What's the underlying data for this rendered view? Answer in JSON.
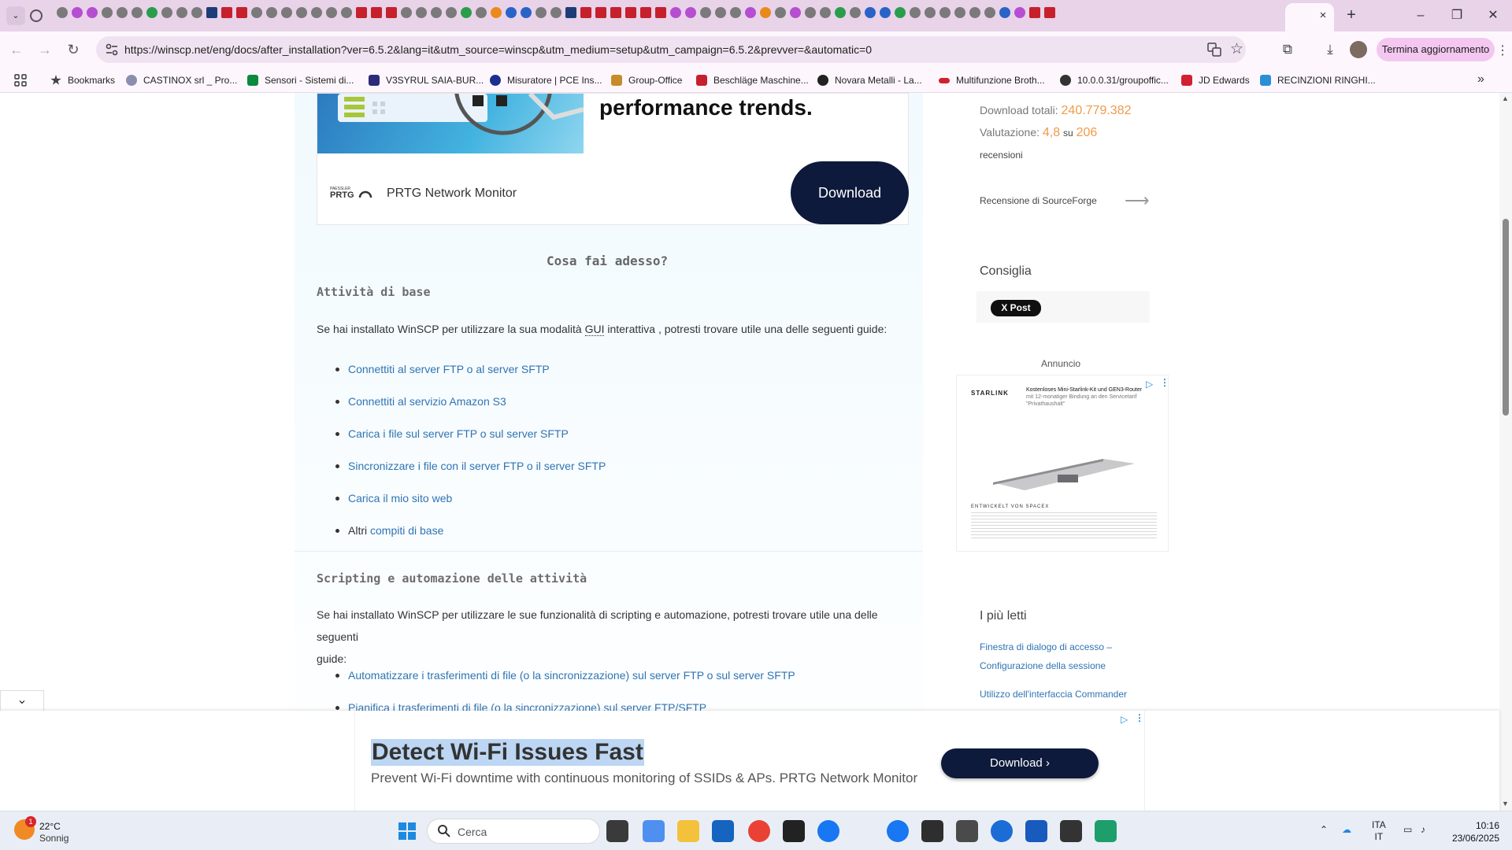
{
  "browser": {
    "tab_close_label": "×",
    "new_tab_label": "+",
    "url": "https://winscp.net/eng/docs/after_installation?ver=6.5.2&lang=it&utm_source=winscp&utm_medium=setup&utm_campaign=6.5.2&prevver=&automatic=0",
    "update_button": "Termina aggiornamento",
    "bookmarks": [
      {
        "label": "Bookmarks",
        "icon": "star-icon",
        "color": "#444444"
      },
      {
        "label": "CASTINOX srl _ Pro...",
        "icon": "globe-icon",
        "color": "#8a8fb0"
      },
      {
        "label": "Sensori - Sistemi di...",
        "icon": "s-logo-icon",
        "color": "#0a8a3c"
      },
      {
        "label": "V3SYRUL SAIA-BUR...",
        "icon": "grid-logo-icon",
        "color": "#2b2b7a"
      },
      {
        "label": "Misuratore | PCE Ins...",
        "icon": "pce-logo-icon",
        "color": "#1d2f8e"
      },
      {
        "label": "Group-Office",
        "icon": "group-office-icon",
        "color": "#c78b2a"
      },
      {
        "label": "Beschläge Maschine...",
        "icon": "k-logo-icon",
        "color": "#c6202c"
      },
      {
        "label": "Novara Metalli - La...",
        "icon": "novara-logo-icon",
        "color": "#222222"
      },
      {
        "label": "Multifunzione Broth...",
        "icon": "brother-logo-icon",
        "color": "#d1202f"
      },
      {
        "label": "10.0.0.31/groupoffic...",
        "icon": "globe-icon",
        "color": "#333333"
      },
      {
        "label": "JD Edwards",
        "icon": "jde-logo-icon",
        "color": "#d1202f"
      },
      {
        "label": "RECINZIONI RINGHI...",
        "icon": "ringhi-logo-icon",
        "color": "#2b8fd6"
      }
    ]
  },
  "top_ad": {
    "headline": "performance trends.",
    "product": "PRTG Network Monitor",
    "brand": "PAESSLER PRTG",
    "download": "Download"
  },
  "content": {
    "title": "Cosa fai adesso?",
    "section1_title": "Attività di base",
    "section1_intro_pre": "Se hai installato WinSCP per utilizzare la sua modalità ",
    "section1_intro_abbr": "GUI",
    "section1_intro_post": " interattiva , potresti trovare utile una delle seguenti guide:",
    "section1_links": [
      "Connettiti al server FTP o al server SFTP",
      "Connettiti al servizio Amazon S3",
      "Carica i file sul server FTP o sul server SFTP",
      "Sincronizzare i file con il server FTP o il server SFTP",
      "Carica il mio sito web"
    ],
    "section1_last_prefix": "Altri ",
    "section1_last_link": "compiti di base",
    "section2_title": "Scripting e automazione delle attività",
    "section2_intro_line1": "Se hai installato WinSCP per utilizzare le sue funzionalità di scripting e automazione, potresti trovare utile una delle seguenti",
    "section2_intro_line2": "guide:",
    "section2_links": [
      "Automatizzare i trasferimenti di file (o la sincronizzazione) sul server FTP o sul server SFTP",
      "Pianifica i trasferimenti di file (o la sincronizzazione) sul server FTP/SFTP"
    ]
  },
  "sidebar": {
    "downloads_label": "Download totali:",
    "downloads_value": "240.779.382",
    "rating_label": "Valutazione:",
    "rating_value": "4,8",
    "rating_su": "su",
    "rating_count": "206",
    "reviews_label": "recensioni",
    "sf_review": "Recensione di SourceForge",
    "sf_arrow": "⟶",
    "recommend_title": "Consiglia",
    "x_post": "X Post",
    "ad_label": "Annuncio",
    "starlink": {
      "logo": "STARLINK",
      "headline": "Kostenloses Mini-Starlink-Kit und GEN3-Router",
      "body": "mit 12-monatiger Bindung an den Servicetarif \"Privathaushalt\"",
      "footer": "ENTWICKELT VON SPACEX"
    },
    "most_read_title": "I più letti",
    "most_read_links": [
      "Finestra di dialogo di accesso –",
      "Configurazione della sessione",
      "Utilizzo dell'interfaccia Commander"
    ]
  },
  "bottom_ad": {
    "headline": "Detect Wi-Fi Issues Fast",
    "sub": "Prevent Wi-Fi downtime with continuous monitoring of SSIDs & APs. PRTG Network Monitor",
    "download": "Download",
    "collapse_icon": "chevron-down-icon"
  },
  "taskbar": {
    "weather_temp": "22°C",
    "weather_desc": "Sonnig",
    "weather_badge": "1",
    "search_placeholder": "Cerca",
    "lang1": "ITA",
    "lang2": "IT",
    "time": "10:16",
    "date": "23/06/2025"
  },
  "colors": {
    "link": "#2f74b3",
    "accent_orange": "#f19a4a",
    "ad_button": "#0e1a3b",
    "tab_strip": "#e8d3e9"
  }
}
